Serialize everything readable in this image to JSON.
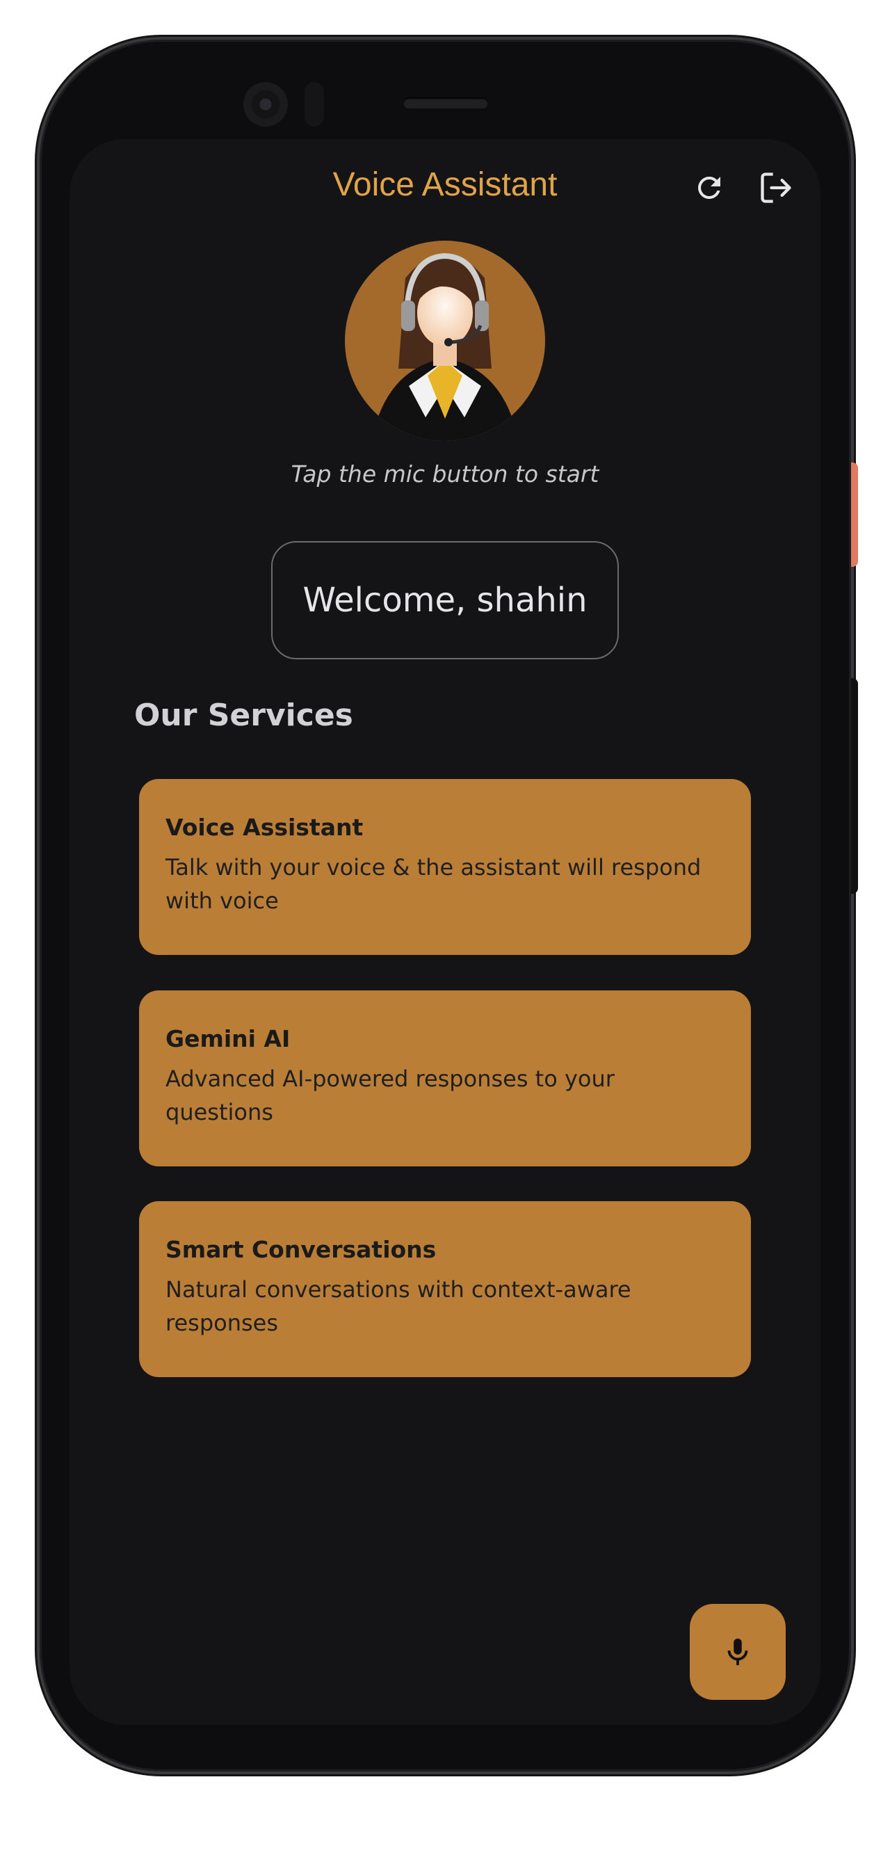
{
  "app": {
    "title": "Voice Assistant"
  },
  "header_icons": {
    "refresh": "refresh-icon",
    "logout": "logout-icon"
  },
  "avatar": {
    "caption": "Tap the mic button to start"
  },
  "welcome": {
    "text": "Welcome, shahin"
  },
  "services": {
    "heading": "Our Services",
    "items": [
      {
        "title": "Voice Assistant",
        "description": "Talk with your voice & the assistant will respond with voice"
      },
      {
        "title": "Gemini AI",
        "description": "Advanced AI-powered responses to your questions"
      },
      {
        "title": "Smart Conversations",
        "description": "Natural conversations with context-aware responses"
      }
    ]
  },
  "fab": {
    "icon": "microphone-icon"
  },
  "colors": {
    "accent": "#bb7e37",
    "title": "#e1a347",
    "background": "#141416"
  }
}
